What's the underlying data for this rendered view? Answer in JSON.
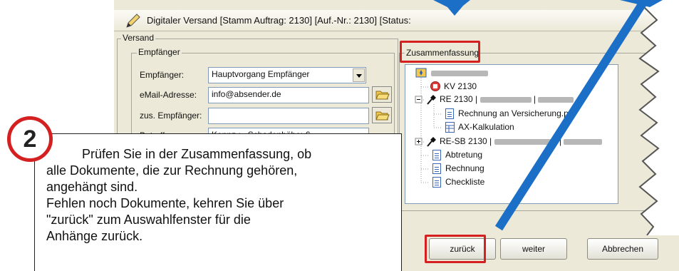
{
  "window": {
    "title": "Digitaler Versand [Stamm Auftrag: 2130]  [Auf.-Nr.: 2130]  [Status:"
  },
  "versand": {
    "group_label": "Versand",
    "empfaenger_group": "Empfänger",
    "fields": {
      "empfaenger_label": "Empfänger:",
      "empfaenger_value": "Hauptvorgang Empfänger",
      "email_label": "eMail-Adresse:",
      "email_value": "info@absender.de",
      "zus_label": "zus. Empfänger:",
      "zus_value": "",
      "betreff_label": "Betreff:",
      "betreff_value": "Kennz.:         , Schadenhöhe:          €"
    }
  },
  "summary": {
    "label": "Zusammenfassung",
    "tree": [
      {
        "text": "KV 2130"
      },
      {
        "text": "RE 2130 |"
      },
      {
        "text": "Rechnung an Versicherung.pdf"
      },
      {
        "text": "AX-Kalkulation"
      },
      {
        "text": "RE-SB 2130 |"
      },
      {
        "text": "Abtretung"
      },
      {
        "text": "Rechnung"
      },
      {
        "text": "Checkliste"
      }
    ]
  },
  "buttons": {
    "back": "zurück",
    "next": "weiter",
    "cancel": "Abbrechen"
  },
  "callout": {
    "step": "2",
    "line1": "Prüfen Sie in der Zusammenfassung, ob",
    "line2": "alle Dokumente, die zur Rechnung gehören,",
    "line3": "angehängt sind.",
    "line4": "Fehlen noch Dokumente, kehren Sie über",
    "line5": "\"zurück\" zum Auswahlfenster für die",
    "line6": "Anhänge zurück."
  },
  "colors": {
    "highlight": "#d42020",
    "arrow": "#1b6fc7",
    "window_bg": "#ece9d8"
  }
}
